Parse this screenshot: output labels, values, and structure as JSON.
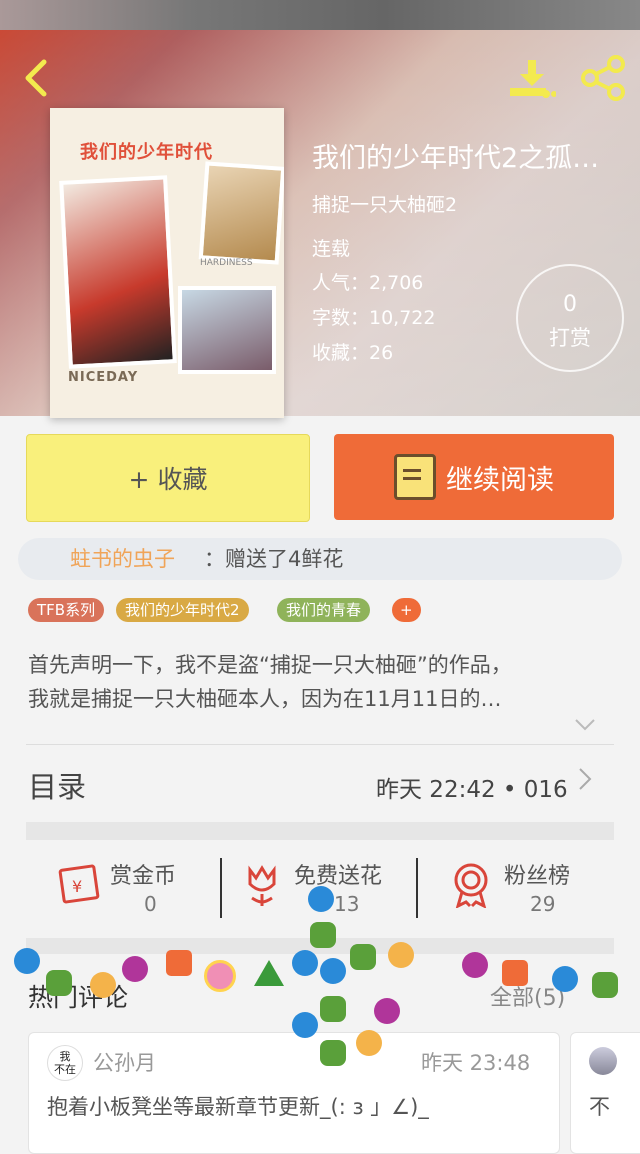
{
  "header": {
    "back_icon": "chevron-left-icon",
    "download_icon": "download-icon",
    "share_icon": "share-icon"
  },
  "cover": {
    "title": "我们的少年时代",
    "caption": "NICEDAY",
    "stamp": "HARDINESS"
  },
  "book": {
    "title": "我们的少年时代2之孤…",
    "author": "捕捉一只大柚砸2",
    "status": "连载",
    "popularity": "人气：2,706",
    "words": "字数：10,722",
    "favorites": "收藏：26"
  },
  "tip": {
    "count": "0",
    "label": "打赏"
  },
  "actions": {
    "favorite": "+ 收藏",
    "read": "继续阅读"
  },
  "gift": {
    "user": "蛀书的虫子",
    "text": "：赠送了4鲜花"
  },
  "tags": [
    {
      "label": "TFB系列",
      "color": "#d9735a"
    },
    {
      "label": "我们的少年时代2",
      "color": "#d9a944"
    },
    {
      "label": "我们的青春",
      "color": "#8fb35a"
    },
    {
      "label": "+",
      "color": "#ef6b38"
    }
  ],
  "description": {
    "line1": "首先声明一下，我不是盗“捕捉一只大柚砸”的作品，",
    "line2": "我就是捕捉一只大柚砸本人，因为在11月11日的…"
  },
  "toc": {
    "label": "目录",
    "info": "昨天  22:42 • 016"
  },
  "features": [
    {
      "label": "赏金币",
      "value": "0",
      "icon": "coin-envelope-icon"
    },
    {
      "label": "免费送花",
      "value": "13",
      "icon": "flower-icon"
    },
    {
      "label": "粉丝榜",
      "value": "29",
      "icon": "rosette-icon"
    }
  ],
  "comments_section": {
    "title": "热门评论",
    "all": "全部(5)"
  },
  "comments": [
    {
      "avatar_text": "我\n不在",
      "name": "公孙月",
      "time": "昨天  23:48",
      "text": "抱着小板凳坐等最新章节更新_(: ɜ 」∠)_"
    },
    {
      "text": "不"
    }
  ],
  "colors": {
    "accent_orange": "#ef6b38",
    "favorite_yellow": "#f9f07c",
    "link_orange": "#f0a458",
    "icon_red": "#d9453a"
  }
}
